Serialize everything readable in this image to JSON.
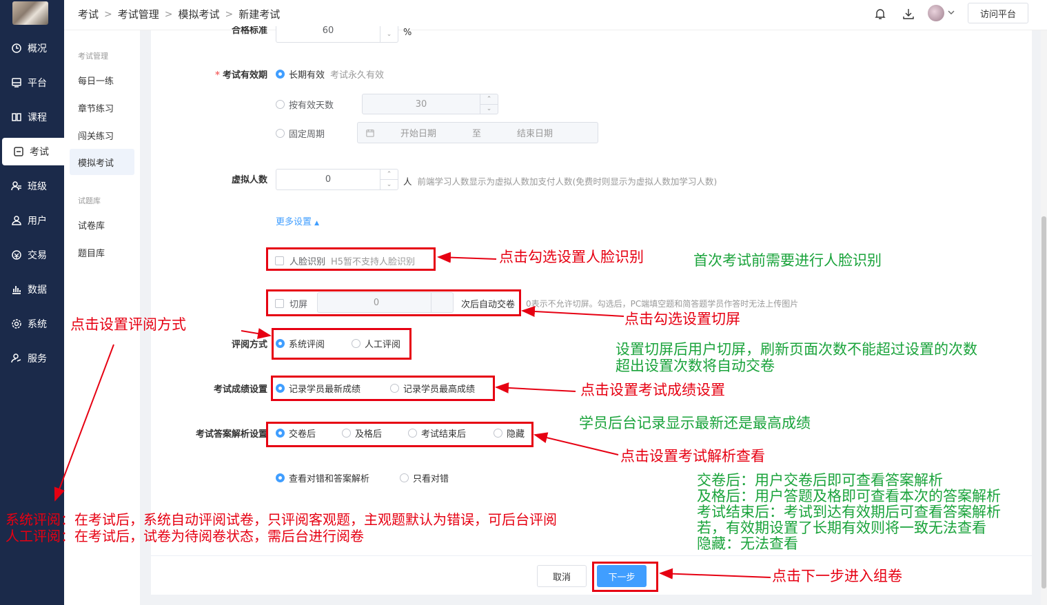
{
  "nav": {
    "items": [
      {
        "label": "概况",
        "icon": "clock-icon"
      },
      {
        "label": "平台",
        "icon": "platform-icon"
      },
      {
        "label": "课程",
        "icon": "book-icon"
      },
      {
        "label": "考试",
        "icon": "exam-icon"
      },
      {
        "label": "班级",
        "icon": "class-icon"
      },
      {
        "label": "用户",
        "icon": "user-icon"
      },
      {
        "label": "交易",
        "icon": "trade-icon"
      },
      {
        "label": "数据",
        "icon": "chart-icon"
      },
      {
        "label": "系统",
        "icon": "gear-icon"
      },
      {
        "label": "服务",
        "icon": "service-icon"
      }
    ],
    "active": "考试"
  },
  "submenu": {
    "group1": "考试管理",
    "items1": [
      "每日一练",
      "章节练习",
      "闯关练习",
      "模拟考试"
    ],
    "group2": "试题库",
    "items2": [
      "试卷库",
      "题目库"
    ],
    "active": "模拟考试"
  },
  "header": {
    "breadcrumb": [
      "考试",
      "考试管理",
      "模拟考试",
      "新建考试"
    ],
    "visit_label": "访问平台"
  },
  "form": {
    "pass_label": "合格标准",
    "pass_value": "60",
    "pass_unit": "%",
    "validity_label": "考试有效期",
    "validity_opt1": "长期有效",
    "validity_opt1_hint": "考试永久有效",
    "validity_opt2": "按有效天数",
    "validity_days": "30",
    "validity_opt3": "固定周期",
    "start_placeholder": "开始日期",
    "to_label": "至",
    "end_placeholder": "结束日期",
    "virtual_label": "虚拟人数",
    "virtual_value": "0",
    "virtual_unit": "人",
    "virtual_hint": "前端学习人数显示为虚拟人数加支付人数(免费时则显示为虚拟人数加学习人数)",
    "more_settings": "更多设置",
    "face_label": "人脸识别",
    "face_hint": "H5暂不支持人脸识别",
    "switch_label": "切屏",
    "switch_value": "0",
    "switch_suffix": "次后自动交卷",
    "switch_hint": "0表示不允许切屏。勾选后，PC端填空题和简答题学员作答时无法上传图片",
    "review_label": "评阅方式",
    "review_opt1": "系统评阅",
    "review_opt2": "人工评阅",
    "score_label": "考试成绩设置",
    "score_opt1": "记录学员最新成绩",
    "score_opt2": "记录学员最高成绩",
    "analysis_label": "考试答案解析设置",
    "analysis_opt1": "交卷后",
    "analysis_opt2": "及格后",
    "analysis_opt3": "考试结束后",
    "analysis_opt4": "隐藏",
    "view_opt1": "查看对错和答案解析",
    "view_opt2": "只看对错",
    "cancel": "取消",
    "next": "下一步"
  },
  "annotations": {
    "face_red": "点击勾选设置人脸识别",
    "face_green": "首次考试前需要进行人脸识别",
    "switch_red": "点击勾选设置切屏",
    "review_red": "点击设置评阅方式",
    "switch_green1": "设置切屏后用户切屏，刷新页面次数不能超过设置的次数",
    "switch_green2": "超出设置次数将自动交卷",
    "score_red": "点击设置考试成绩设置",
    "score_green": "学员后台记录显示最新还是最高成绩",
    "analysis_red": "点击设置考试解析查看",
    "analysis_green1": "交卷后：用户交卷后即可查看答案解析",
    "analysis_green2": "及格后：用户答题及格即可查看本次的答案解析",
    "analysis_green3": "考试结束后：考试到达有效期后可查看答案解析",
    "analysis_green4": "若，有效期设置了长期有效则将一致无法查看",
    "analysis_green5": "隐藏：无法查看",
    "review_desc1": "系统评阅：在考试后，系统自动评阅试卷，只评阅客观题，主观题默认为错误，可后台评阅",
    "review_desc2": "人工评阅：在考试后，试卷为待阅卷状态，需后台进行阅卷",
    "next_red": "点击下一步进入组卷"
  },
  "colors": {
    "nav_bg": "#1b2a4a",
    "primary": "#409eff",
    "annot_red": "#e60012",
    "annot_green": "#1aa33b"
  }
}
